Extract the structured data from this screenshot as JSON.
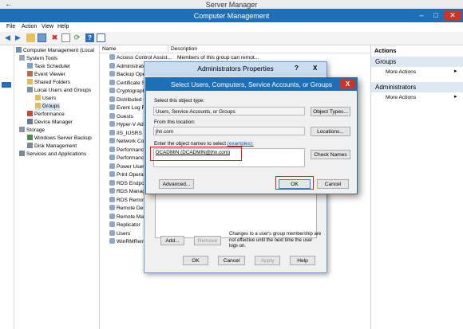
{
  "server_manager": {
    "title": "Server Manager"
  },
  "window": {
    "title": "Computer Management",
    "minimize": "–",
    "maximize": "□",
    "close": "✕"
  },
  "menu": [
    "File",
    "Action",
    "View",
    "Help"
  ],
  "tree": [
    {
      "label": "Computer Management (Local"
    },
    {
      "label": "System Tools"
    },
    {
      "label": "Task Scheduler"
    },
    {
      "label": "Event Viewer"
    },
    {
      "label": "Shared Folders"
    },
    {
      "label": "Local Users and Groups"
    },
    {
      "label": "Users"
    },
    {
      "label": "Groups"
    },
    {
      "label": "Performance"
    },
    {
      "label": "Device Manager"
    },
    {
      "label": "Storage"
    },
    {
      "label": "Windows Server Backup"
    },
    {
      "label": "Disk Management"
    },
    {
      "label": "Services and Applications"
    }
  ],
  "columns": {
    "name": "Name",
    "description": "Description"
  },
  "groups": [
    {
      "name": "Access Control Assist...",
      "description": "Members of this group can remot..."
    },
    {
      "name": "Administrato"
    },
    {
      "name": "Backup Oper"
    },
    {
      "name": "Certificate Se"
    },
    {
      "name": "Cryptograph"
    },
    {
      "name": "Distributed C"
    },
    {
      "name": "Event Log Re"
    },
    {
      "name": "Guests"
    },
    {
      "name": "Hyper-V Adm"
    },
    {
      "name": "IIS_IUSRS"
    },
    {
      "name": "Network Con"
    },
    {
      "name": "Performance"
    },
    {
      "name": "Performance"
    },
    {
      "name": "Power Users"
    },
    {
      "name": "Print Operato"
    },
    {
      "name": "RDS Endpoin"
    },
    {
      "name": "RDS Manage"
    },
    {
      "name": "RDS Remote"
    },
    {
      "name": "Remote Desk"
    },
    {
      "name": "Remote Mana"
    },
    {
      "name": "Replicator"
    },
    {
      "name": "Users"
    },
    {
      "name": "WinRMRemo"
    }
  ],
  "actions": {
    "header": "Actions",
    "section1": "Groups",
    "more1": "More Actions",
    "section2": "Administrators",
    "more2": "More Actions"
  },
  "props_dialog": {
    "title": "Administrators Properties",
    "help": "?",
    "close": "X",
    "add": "Add...",
    "remove": "Remove",
    "note": "Changes to a user's group membership are not effective until the next time the user logs on.",
    "ok": "OK",
    "cancel": "Cancel",
    "apply": "Apply",
    "help_button": "Help"
  },
  "select_dialog": {
    "title": "Select Users, Computers, Service Accounts, or Groups",
    "close": "X",
    "object_type_label": "Select this object type:",
    "object_type_value": "Users, Service Accounts, or Groups",
    "object_types_button": "Object Types...",
    "location_label": "From this location:",
    "location_value": "jhn.com",
    "locations_button": "Locations...",
    "names_label": "Enter the object names to select",
    "examples_link": "(examples):",
    "names_value": "DCADMIN (DCADMIN@jhn.com)",
    "check_names_button": "Check Names",
    "advanced_button": "Advanced...",
    "ok_button": "OK",
    "cancel_button": "Cancel"
  }
}
